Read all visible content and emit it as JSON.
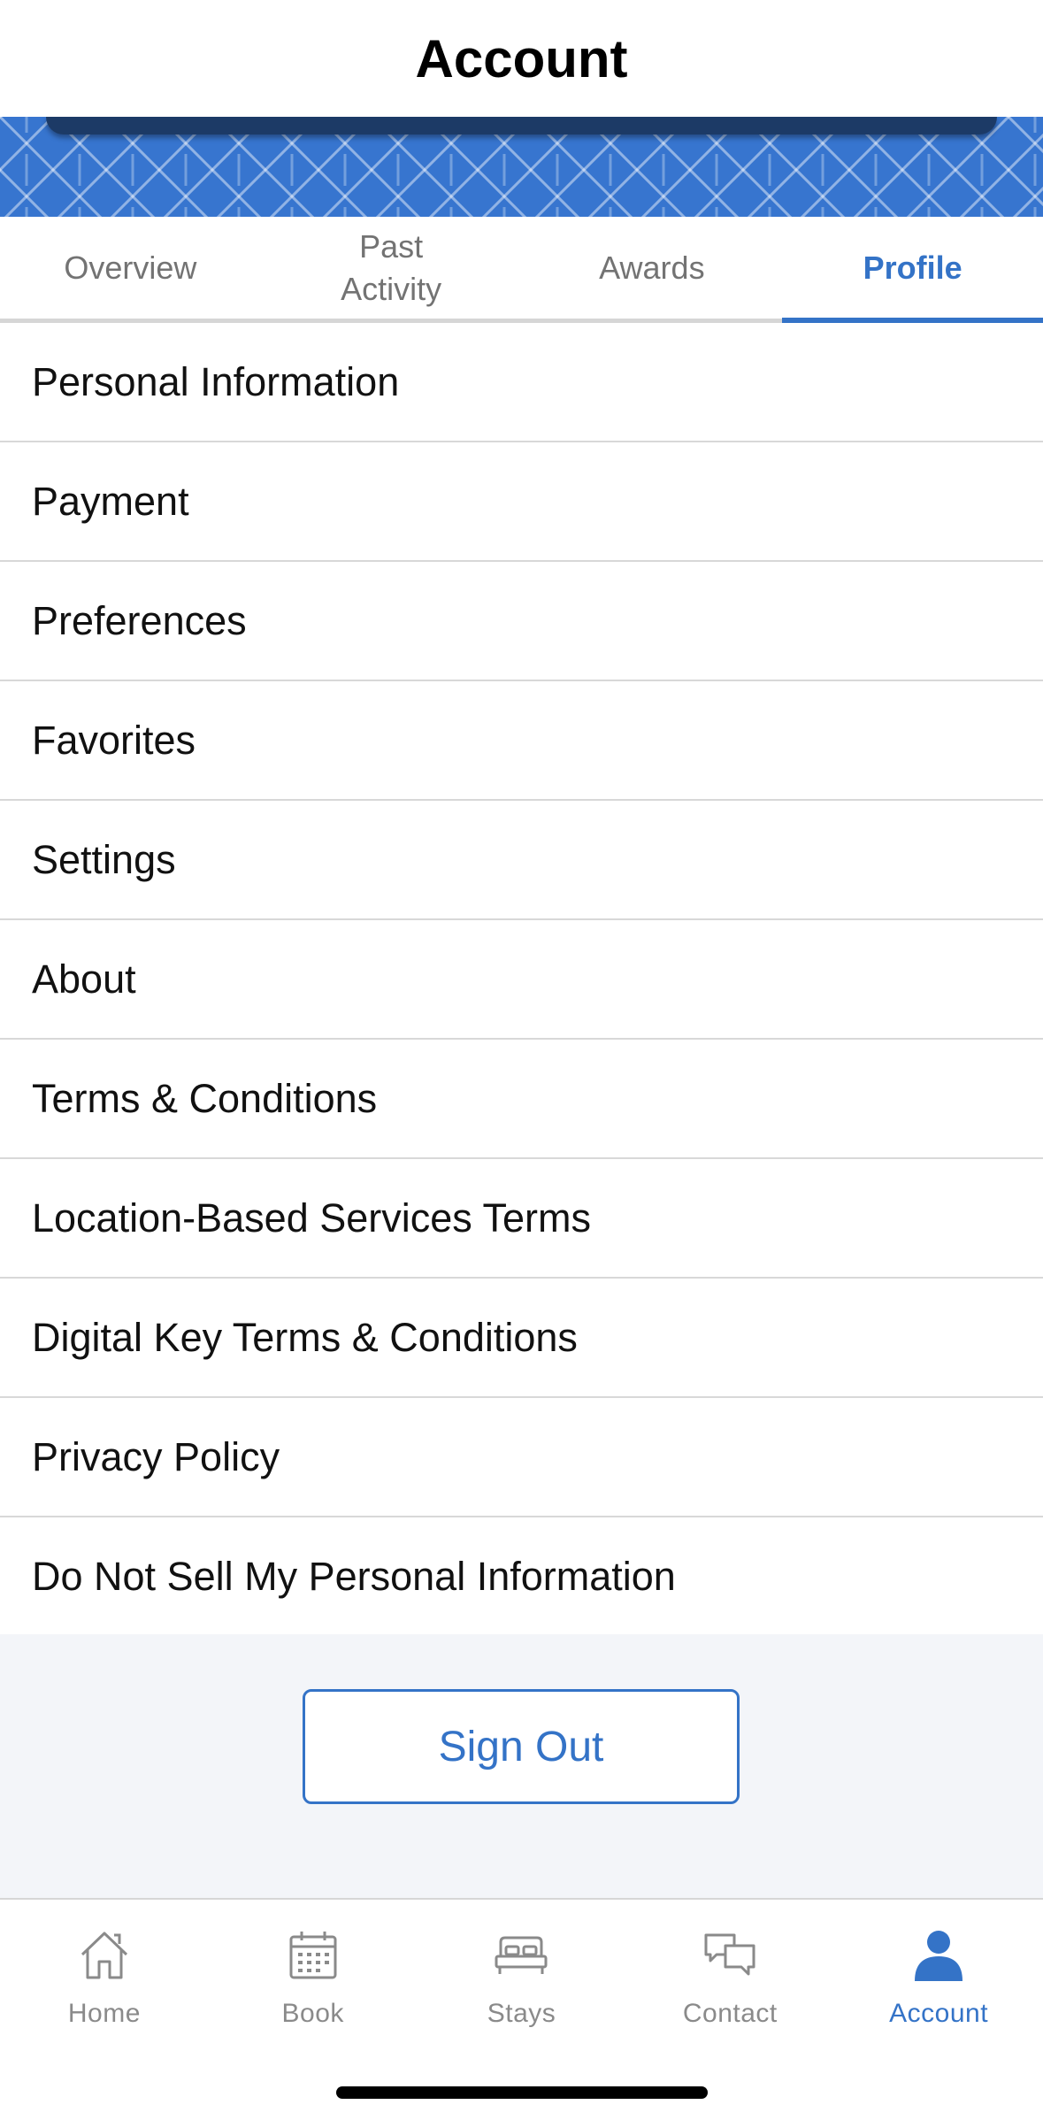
{
  "header": {
    "title": "Account"
  },
  "tabs": [
    {
      "label": "Overview",
      "active": false
    },
    {
      "label": "Past\nActivity",
      "active": false
    },
    {
      "label": "Awards",
      "active": false
    },
    {
      "label": "Profile",
      "active": true
    }
  ],
  "menu": {
    "items": [
      "Personal Information",
      "Payment",
      "Preferences",
      "Favorites",
      "Settings",
      "About",
      "Terms & Conditions",
      "Location-Based Services Terms",
      "Digital Key Terms & Conditions",
      "Privacy Policy",
      "Do Not Sell My Personal Information"
    ]
  },
  "sign_out": {
    "label": "Sign Out"
  },
  "tabbar": {
    "items": [
      {
        "label": "Home",
        "icon": "house-icon",
        "active": false
      },
      {
        "label": "Book",
        "icon": "calendar-icon",
        "active": false
      },
      {
        "label": "Stays",
        "icon": "bed-icon",
        "active": false
      },
      {
        "label": "Contact",
        "icon": "chat-bubbles-icon",
        "active": false
      },
      {
        "label": "Account",
        "icon": "person-icon",
        "active": true
      }
    ]
  },
  "colors": {
    "accent": "#3473c7",
    "banner": "#3775cf",
    "inactive": "#8a8a8a"
  }
}
